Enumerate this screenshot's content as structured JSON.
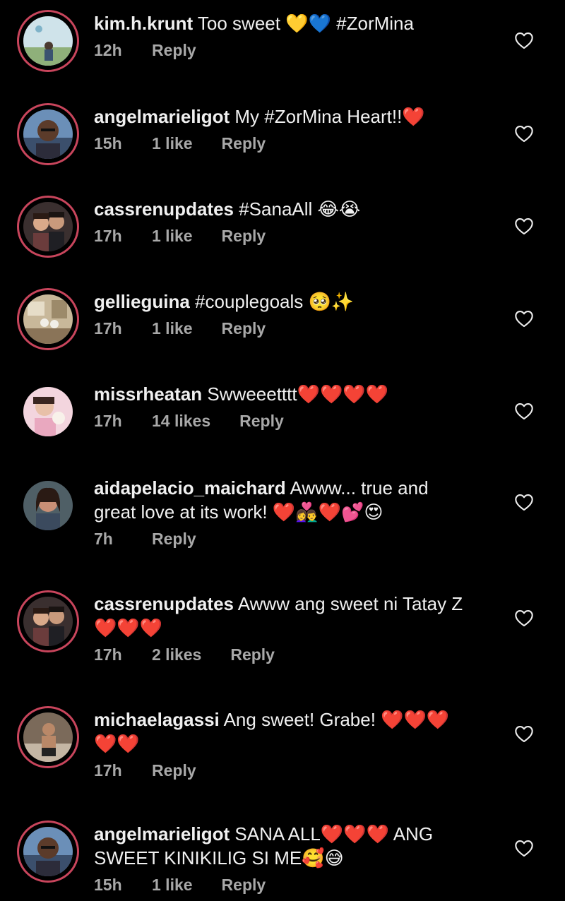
{
  "comments": [
    {
      "username": "kim.h.krunt",
      "lines": [
        "Too sweet 💛💙 #ZorMina"
      ],
      "time": "12h",
      "likes": "",
      "reply": "Reply",
      "avatar": "avatar-outdoor",
      "ring": true
    },
    {
      "username": "angelmarieligot",
      "lines": [
        "My #ZorMina Heart!!❤️"
      ],
      "time": "15h",
      "likes": "1 like",
      "reply": "Reply",
      "avatar": "avatar-person-glasses",
      "ring": true
    },
    {
      "username": "cassrenupdates",
      "lines": [
        "#SanaAll 😂😭"
      ],
      "time": "17h",
      "likes": "1 like",
      "reply": "Reply",
      "avatar": "avatar-couple",
      "ring": true
    },
    {
      "username": "gellieguina",
      "lines": [
        "#couplegoals 🥺✨"
      ],
      "time": "17h",
      "likes": "1 like",
      "reply": "Reply",
      "avatar": "avatar-room",
      "ring": true
    },
    {
      "username": "missrheatan",
      "lines": [
        "Swweeetttt❤️❤️❤️❤️"
      ],
      "time": "17h",
      "likes": "14 likes",
      "reply": "Reply",
      "avatar": "avatar-woman-pink",
      "ring": false
    },
    {
      "username": "aidapelacio_maichard",
      "lines": [
        "Awww... true and",
        "great love at its work! ❤️👩‍❤️‍👨❤️💕😍"
      ],
      "time": "7h",
      "likes": "",
      "reply": "Reply",
      "avatar": "avatar-woman",
      "ring": false
    },
    {
      "username": "cassrenupdates",
      "lines": [
        "Awww ang sweet ni Tatay Z",
        "❤️❤️❤️"
      ],
      "time": "17h",
      "likes": "2 likes",
      "reply": "Reply",
      "avatar": "avatar-couple",
      "ring": true
    },
    {
      "username": "michaelagassi",
      "lines": [
        "Ang sweet! Grabe! ❤️❤️❤️",
        "❤️❤️"
      ],
      "time": "17h",
      "likes": "",
      "reply": "Reply",
      "avatar": "avatar-man",
      "ring": true
    },
    {
      "username": "angelmarieligot",
      "lines": [
        "SANA ALL❤️❤️❤️ ANG",
        "SWEET KINIKILIG SI ME🥰😅"
      ],
      "time": "15h",
      "likes": "1 like",
      "reply": "Reply",
      "avatar": "avatar-person-glasses",
      "ring": true
    }
  ],
  "icons": {
    "like": "heart-outline-icon"
  },
  "colors": {
    "background": "#000000",
    "text": "#f0f0f0",
    "meta": "#a8a8a8",
    "story_ring": "#c8455c"
  }
}
